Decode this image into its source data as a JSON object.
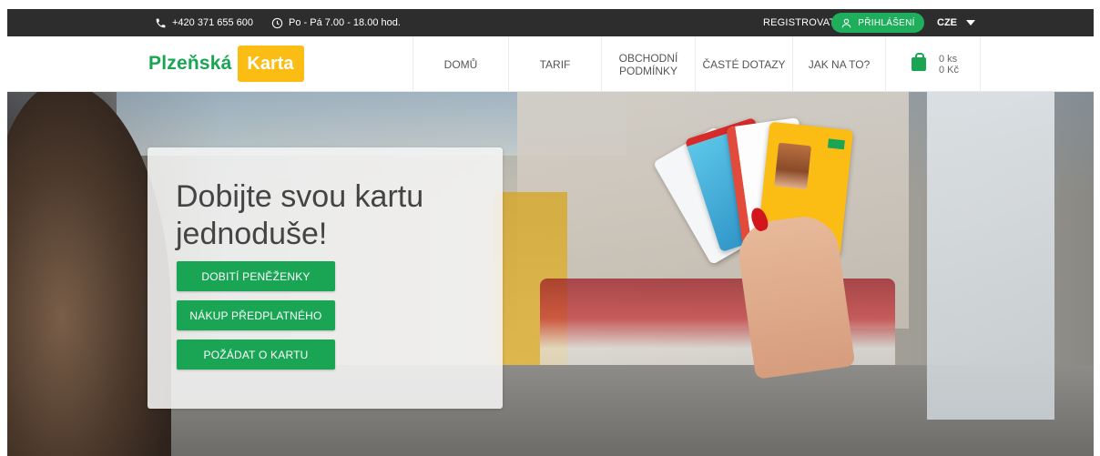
{
  "topbar": {
    "phone": "+420 371 655 600",
    "hours": "Po - Pá 7.00 - 18.00 hod.",
    "register": "REGISTROVAT",
    "login": "PŘIHLÁŠENÍ",
    "language": "CZE"
  },
  "logo": {
    "word1": "Plzeňská",
    "word2": "Karta"
  },
  "nav": {
    "items": [
      {
        "label": "DOMŮ"
      },
      {
        "label": "TARIF"
      },
      {
        "label_line1": "OBCHODNÍ",
        "label_line2": "PODMÍNKY"
      },
      {
        "label": "ČASTÉ DOTAZY"
      },
      {
        "label": "JAK NA TO?"
      }
    ],
    "cart": {
      "count": "0 ks",
      "total": "0 Kč"
    }
  },
  "hero": {
    "title_line1": "Dobijte svou kartu",
    "title_line2": "jednoduše!",
    "buttons": [
      {
        "label": "DOBITÍ PENĚŽENKY"
      },
      {
        "label": "NÁKUP PŘEDPLATNÉHO"
      },
      {
        "label": "POŽÁDAT O KARTU"
      }
    ]
  },
  "colors": {
    "brand_green": "#1aa554",
    "brand_yellow": "#fbbc13",
    "topbar_bg": "#2d2d2d"
  },
  "icons": {
    "phone": "phone-icon",
    "clock": "clock-icon",
    "user": "user-icon",
    "caret": "chevron-down-icon",
    "cart": "shopping-bag-icon"
  }
}
